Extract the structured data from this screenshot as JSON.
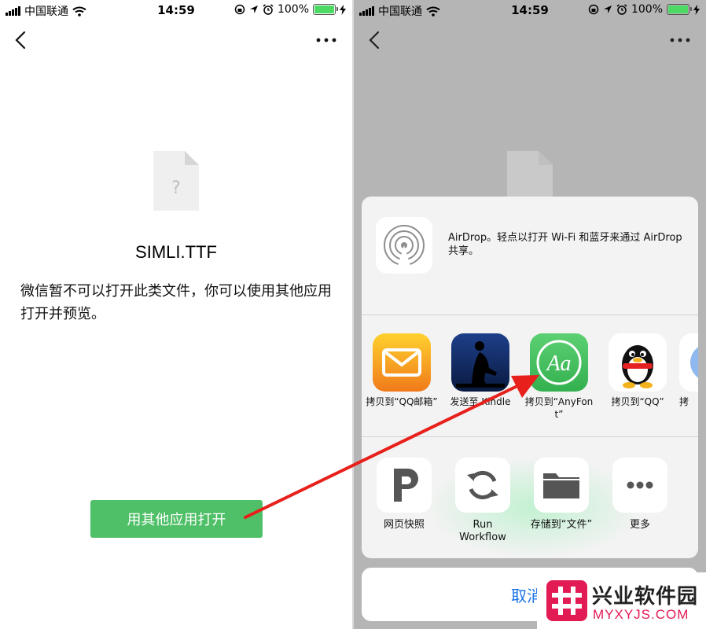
{
  "status_bar": {
    "carrier": "中国联通",
    "time": "14:59",
    "battery": "100%",
    "battery_level": 1.0
  },
  "left": {
    "file_name": "SIMLI.TTF",
    "file_icon_glyph": "?",
    "message": "微信暂不可以打开此类文件，你可以使用其他应用打开并预览。",
    "open_button": "用其他应用打开",
    "icons": [
      "back-chevron-icon",
      "more-dots-icon",
      "unknown-file-icon"
    ]
  },
  "share_sheet": {
    "airdrop": {
      "text": "AirDrop。轻点以打开 Wi-Fi 和蓝牙来通过 AirDrop 共享。",
      "icon": "airdrop-icon"
    },
    "apps": [
      {
        "label": "拷贝到“QQ邮箱”",
        "icon": "qq-mail-icon"
      },
      {
        "label": "发送至 Kindle",
        "icon": "kindle-icon"
      },
      {
        "label": "拷贝到“AnyFont”",
        "icon": "anyfont-icon",
        "tile_text": "Aa"
      },
      {
        "label": "拷贝到“QQ”",
        "icon": "qq-penguin-icon"
      },
      {
        "label": "拷",
        "icon": "partial-app-icon"
      }
    ],
    "actions": [
      {
        "label": "网页快照",
        "icon": "p-snapshot-icon"
      },
      {
        "label": "Run Workflow",
        "icon": "refresh-icon"
      },
      {
        "label": "存储到“文件”",
        "icon": "folder-icon"
      },
      {
        "label": "更多",
        "icon": "more-dots-icon"
      }
    ],
    "cancel": "取消"
  },
  "watermark": {
    "name": "兴业软件园",
    "url": "MYXYJS.COM",
    "icon": "hash-logo-icon"
  },
  "colors": {
    "accent_green": "#4fc067",
    "cancel_blue": "#1a73e8",
    "arrow_red": "#e8201c",
    "watermark_pink": "#e21b54"
  }
}
